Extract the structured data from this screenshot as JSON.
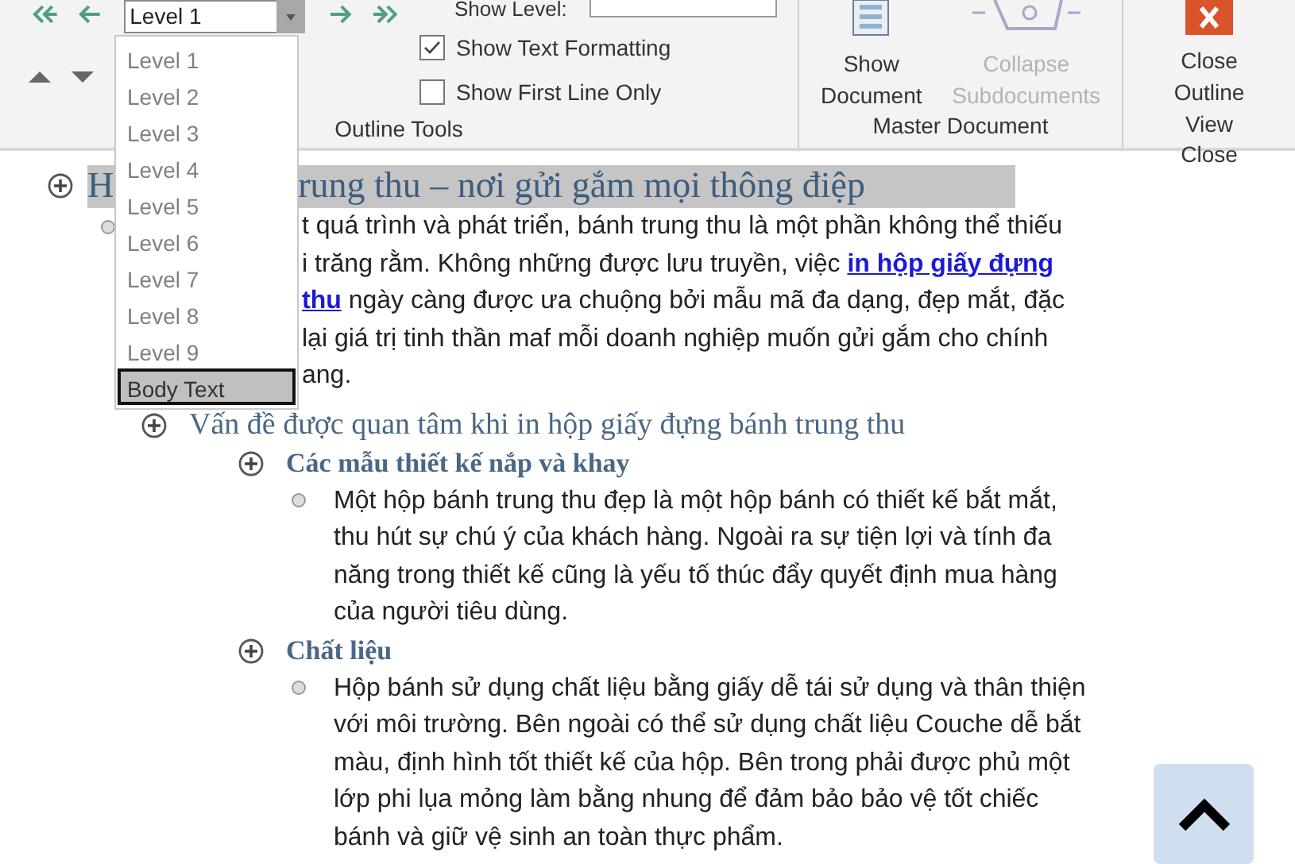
{
  "ribbon": {
    "level_combo": {
      "value": "Level 1"
    },
    "show_level": {
      "label": "Show Level:"
    },
    "checkboxes": [
      {
        "label": "Show Text Formatting",
        "checked": true
      },
      {
        "label": "Show First Line Only",
        "checked": false
      }
    ],
    "master_buttons": [
      {
        "label": "Show Document",
        "disabled": false
      },
      {
        "label": "Collapse Subdocuments",
        "disabled": true
      }
    ],
    "close_button": {
      "label": "Close Outline View"
    },
    "group_labels": [
      "Outline Tools",
      "Master Document",
      "Close"
    ]
  },
  "level_dropdown": {
    "open": true,
    "items": [
      {
        "label": "Level 1",
        "selected": false
      },
      {
        "label": "Level 2",
        "selected": false
      },
      {
        "label": "Level 3",
        "selected": false
      },
      {
        "label": "Level 4",
        "selected": false
      },
      {
        "label": "Level 5",
        "selected": false
      },
      {
        "label": "Level 6",
        "selected": false
      },
      {
        "label": "Level 7",
        "selected": false
      },
      {
        "label": "Level 8",
        "selected": false
      },
      {
        "label": "Level 9",
        "selected": false
      },
      {
        "label": "Body Text",
        "selected": true
      }
    ]
  },
  "document": {
    "outline": [
      {
        "kind": "heading1",
        "text_parts": [
          "H",
          "rung thu – nơi gửi gắm mọi thông điệp"
        ],
        "children": [
          {
            "kind": "body",
            "lines": [
              [
                {
                  "text": "t quá trình và phát triển, bánh trung thu là một phần không thể thiếu"
                }
              ],
              [
                {
                  "text": "i trăng rằm. Không những được lưu truyền, việc "
                },
                {
                  "text": "in hộp giấy đựng",
                  "link": true
                }
              ],
              [
                {
                  "text": "thu",
                  "link": true
                },
                {
                  "text": " ngày càng được ưa chuộng bởi mẫu mã đa dạng, đẹp mắt, đặc"
                }
              ],
              [
                {
                  "text": "lại giá trị tinh thần maf mỗi doanh nghiệp muốn gửi gắm cho chính"
                }
              ],
              [
                {
                  "text": "ang."
                }
              ]
            ]
          },
          {
            "kind": "heading2",
            "text_parts": [
              "Vấn đề được quan tâm khi in hộp giấy đựng bánh trung thu"
            ],
            "children": [
              {
                "kind": "heading3",
                "text_parts": [
                  "Các mẫu thiết kế nắp và khay"
                ],
                "children": [
                  {
                    "kind": "body",
                    "lines": [
                      [
                        {
                          "text": "Một hộp bánh trung thu đẹp là một hộp bánh có thiết kế bắt mắt,"
                        }
                      ],
                      [
                        {
                          "text": "thu hút sự chú ý của khách hàng. Ngoài ra sự tiện lợi và tính đa"
                        }
                      ],
                      [
                        {
                          "text": "năng trong thiết kế cũng là yếu tố thúc đẩy quyết định mua hàng"
                        }
                      ],
                      [
                        {
                          "text": "của người tiêu dùng."
                        }
                      ]
                    ]
                  }
                ]
              },
              {
                "kind": "heading3",
                "text_parts": [
                  "Chất liệu"
                ],
                "children": [
                  {
                    "kind": "body",
                    "lines": [
                      [
                        {
                          "text": "Hộp bánh sử dụng chất liệu bằng giấy dễ tái sử dụng và thân thiện"
                        }
                      ],
                      [
                        {
                          "text": "với môi trường. Bên ngoài có thể sử dụng chất liệu Couche dễ bắt"
                        }
                      ],
                      [
                        {
                          "text": "màu, định hình tốt thiết kế của hộp. Bên trong phải được phủ một"
                        }
                      ],
                      [
                        {
                          "text": "lớp phi lụa mỏng làm bằng nhung để đảm bảo bảo vệ tốt chiếc"
                        }
                      ],
                      [
                        {
                          "text": "bánh và giữ vệ sinh an toàn thực phẩm."
                        }
                      ]
                    ]
                  }
                ]
              }
            ]
          }
        ]
      }
    ]
  },
  "scroll_top_button": {
    "visible": true
  }
}
